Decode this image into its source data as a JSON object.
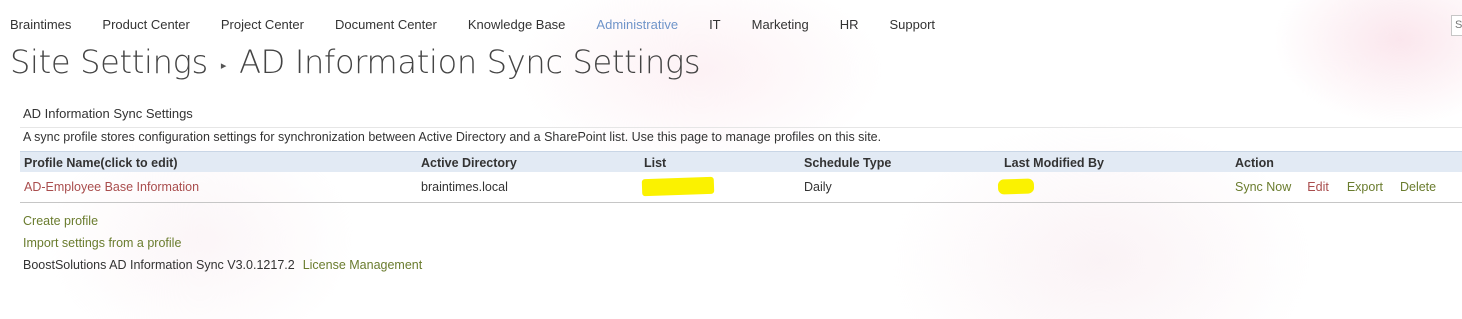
{
  "nav": {
    "items": [
      {
        "label": "Braintimes",
        "selected": false
      },
      {
        "label": "Product Center",
        "selected": false
      },
      {
        "label": "Project Center",
        "selected": false
      },
      {
        "label": "Document Center",
        "selected": false
      },
      {
        "label": "Knowledge Base",
        "selected": false
      },
      {
        "label": "Administrative",
        "selected": true
      },
      {
        "label": "IT",
        "selected": false
      },
      {
        "label": "Marketing",
        "selected": false
      },
      {
        "label": "HR",
        "selected": false
      },
      {
        "label": "Support",
        "selected": false
      }
    ],
    "search_partial": "S"
  },
  "title": {
    "root": "Site Settings",
    "separator_icon": "breadcrumb-arrow",
    "current": "AD Information Sync Settings"
  },
  "section": {
    "heading": "AD Information Sync Settings",
    "description": "A sync profile stores configuration settings for synchronization between Active Directory and a SharePoint list. Use this page to manage profiles on this site."
  },
  "table": {
    "headers": [
      "Profile Name(click to edit)",
      "Active Directory",
      "List",
      "Schedule Type",
      "Last Modified By",
      "Action"
    ],
    "rows": [
      {
        "profile_name": "AD-Employee Base Information",
        "active_directory": "braintimes.local",
        "list": "",
        "schedule_type": "Daily",
        "last_modified_by": "",
        "actions": {
          "sync": "Sync Now",
          "edit": "Edit",
          "export": "Export",
          "delete": "Delete"
        }
      }
    ]
  },
  "footer": {
    "create_profile": "Create profile",
    "import_settings": "Import settings from a profile",
    "version": "BoostSolutions AD Information Sync V3.0.1217.2",
    "license": "License Management"
  },
  "colors": {
    "nav_selected": "#6f94c9",
    "header_bg": "#e0e9f3",
    "link_red": "#a94d4d",
    "link_green": "#6a7c2e",
    "redaction": "#fbf200"
  }
}
